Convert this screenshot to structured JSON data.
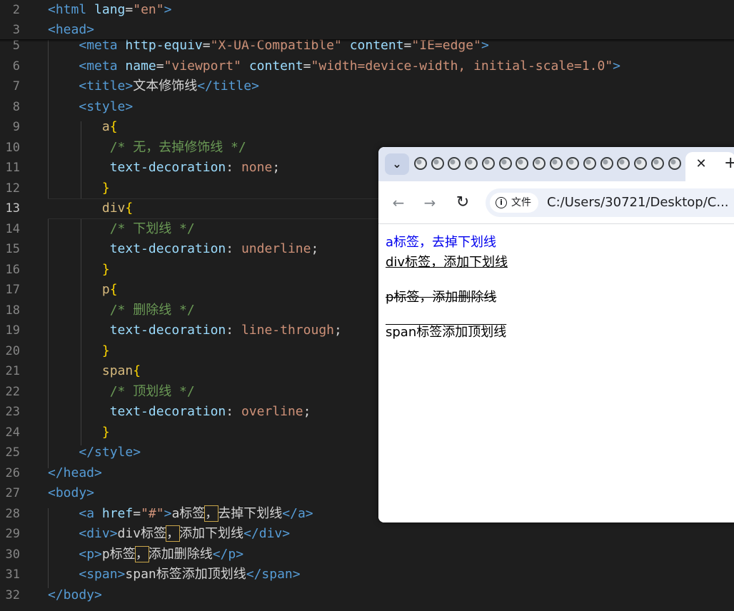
{
  "editor": {
    "lines": [
      {
        "n": "2",
        "tokens": [
          [
            "t-tag",
            "<html "
          ],
          [
            "t-attr",
            "lang"
          ],
          [
            "t-txt",
            "="
          ],
          [
            "t-str",
            "\"en\""
          ],
          [
            "t-tag",
            ">"
          ]
        ]
      },
      {
        "n": "3",
        "tokens": [
          [
            "t-tag",
            "<head>"
          ]
        ]
      },
      {
        "n": "5",
        "tokens": [
          [
            "t-txt",
            "    "
          ],
          [
            "t-tag",
            "<meta "
          ],
          [
            "t-attr",
            "http-equiv"
          ],
          [
            "t-txt",
            "="
          ],
          [
            "t-str",
            "\"X-UA-Compatible\""
          ],
          [
            "t-txt",
            " "
          ],
          [
            "t-attr",
            "content"
          ],
          [
            "t-txt",
            "="
          ],
          [
            "t-str",
            "\"IE=edge\""
          ],
          [
            "t-tag",
            ">"
          ]
        ]
      },
      {
        "n": "6",
        "tokens": [
          [
            "t-txt",
            "    "
          ],
          [
            "t-tag",
            "<meta "
          ],
          [
            "t-attr",
            "name"
          ],
          [
            "t-txt",
            "="
          ],
          [
            "t-str",
            "\"viewport\""
          ],
          [
            "t-txt",
            " "
          ],
          [
            "t-attr",
            "content"
          ],
          [
            "t-txt",
            "="
          ],
          [
            "t-str",
            "\"width=device-width, initial-scale=1.0\""
          ],
          [
            "t-tag",
            ">"
          ]
        ]
      },
      {
        "n": "7",
        "tokens": [
          [
            "t-txt",
            "    "
          ],
          [
            "t-tag",
            "<title>"
          ],
          [
            "t-txt",
            "文本修饰线"
          ],
          [
            "t-tag",
            "</title>"
          ]
        ]
      },
      {
        "n": "8",
        "tokens": [
          [
            "t-txt",
            "    "
          ],
          [
            "t-tag",
            "<style>"
          ]
        ]
      },
      {
        "n": "9",
        "tokens": [
          [
            "t-txt",
            "       "
          ],
          [
            "t-sel",
            "a"
          ],
          [
            "t-brace",
            "{"
          ]
        ]
      },
      {
        "n": "10",
        "tokens": [
          [
            "t-txt",
            "        "
          ],
          [
            "t-cmt",
            "/* 无，去掉修饰线 */"
          ]
        ]
      },
      {
        "n": "11",
        "tokens": [
          [
            "t-txt",
            "        "
          ],
          [
            "t-prop",
            "text-decoration"
          ],
          [
            "t-txt",
            ": "
          ],
          [
            "t-val",
            "none"
          ],
          [
            "t-txt",
            ";"
          ]
        ]
      },
      {
        "n": "12",
        "tokens": [
          [
            "t-txt",
            "       "
          ],
          [
            "t-brace",
            "}"
          ]
        ]
      },
      {
        "n": "13",
        "tokens": [
          [
            "t-txt",
            "       "
          ],
          [
            "t-sel",
            "div"
          ],
          [
            "t-brace",
            "{"
          ]
        ]
      },
      {
        "n": "14",
        "tokens": [
          [
            "t-txt",
            "        "
          ],
          [
            "t-cmt",
            "/* 下划线 */"
          ]
        ]
      },
      {
        "n": "15",
        "tokens": [
          [
            "t-txt",
            "        "
          ],
          [
            "t-prop",
            "text-decoration"
          ],
          [
            "t-txt",
            ": "
          ],
          [
            "t-val",
            "underline"
          ],
          [
            "t-txt",
            ";"
          ]
        ]
      },
      {
        "n": "16",
        "tokens": [
          [
            "t-txt",
            "       "
          ],
          [
            "t-brace",
            "}"
          ]
        ]
      },
      {
        "n": "17",
        "tokens": [
          [
            "t-txt",
            "       "
          ],
          [
            "t-sel",
            "p"
          ],
          [
            "t-brace",
            "{"
          ]
        ]
      },
      {
        "n": "18",
        "tokens": [
          [
            "t-txt",
            "        "
          ],
          [
            "t-cmt",
            "/* 删除线 */"
          ]
        ]
      },
      {
        "n": "19",
        "tokens": [
          [
            "t-txt",
            "        "
          ],
          [
            "t-prop",
            "text-decoration"
          ],
          [
            "t-txt",
            ": "
          ],
          [
            "t-val",
            "line-through"
          ],
          [
            "t-txt",
            ";"
          ]
        ]
      },
      {
        "n": "20",
        "tokens": [
          [
            "t-txt",
            "       "
          ],
          [
            "t-brace",
            "}"
          ]
        ]
      },
      {
        "n": "21",
        "tokens": [
          [
            "t-txt",
            "       "
          ],
          [
            "t-sel",
            "span"
          ],
          [
            "t-brace",
            "{"
          ]
        ]
      },
      {
        "n": "22",
        "tokens": [
          [
            "t-txt",
            "        "
          ],
          [
            "t-cmt",
            "/* 顶划线 */"
          ]
        ]
      },
      {
        "n": "23",
        "tokens": [
          [
            "t-txt",
            "        "
          ],
          [
            "t-prop",
            "text-decoration"
          ],
          [
            "t-txt",
            ": "
          ],
          [
            "t-val",
            "overline"
          ],
          [
            "t-txt",
            ";"
          ]
        ]
      },
      {
        "n": "24",
        "tokens": [
          [
            "t-txt",
            "       "
          ],
          [
            "t-brace",
            "}"
          ]
        ]
      },
      {
        "n": "25",
        "tokens": [
          [
            "t-txt",
            "    "
          ],
          [
            "t-tag",
            "</style>"
          ]
        ]
      },
      {
        "n": "26",
        "tokens": [
          [
            "t-tag",
            "</head>"
          ]
        ]
      },
      {
        "n": "27",
        "tokens": [
          [
            "t-tag",
            "<body>"
          ]
        ]
      },
      {
        "n": "28",
        "tokens": [
          [
            "t-txt",
            "    "
          ],
          [
            "t-tag",
            "<a "
          ],
          [
            "t-attr",
            "href"
          ],
          [
            "t-txt",
            "="
          ],
          [
            "t-str",
            "\"#\""
          ],
          [
            "t-tag",
            ">"
          ],
          [
            "t-txt",
            "a标签"
          ],
          [
            "box",
            "，"
          ],
          [
            "t-txt",
            "去掉下划线"
          ],
          [
            "t-tag",
            "</a>"
          ]
        ]
      },
      {
        "n": "29",
        "tokens": [
          [
            "t-txt",
            "    "
          ],
          [
            "t-tag",
            "<div>"
          ],
          [
            "t-txt",
            "div标签"
          ],
          [
            "box",
            "，"
          ],
          [
            "t-txt",
            "添加下划线"
          ],
          [
            "t-tag",
            "</div>"
          ]
        ]
      },
      {
        "n": "30",
        "tokens": [
          [
            "t-txt",
            "    "
          ],
          [
            "t-tag",
            "<p>"
          ],
          [
            "t-txt",
            "p标签"
          ],
          [
            "box",
            "，"
          ],
          [
            "t-txt",
            "添加删除线"
          ],
          [
            "t-tag",
            "</p>"
          ]
        ]
      },
      {
        "n": "31",
        "tokens": [
          [
            "t-txt",
            "    "
          ],
          [
            "t-tag",
            "<span>"
          ],
          [
            "t-txt",
            "span标签添加顶划线"
          ],
          [
            "t-tag",
            "</span>"
          ]
        ]
      },
      {
        "n": "32",
        "tokens": [
          [
            "t-tag",
            "</body>"
          ]
        ]
      }
    ],
    "current_line": "13"
  },
  "browser": {
    "tab_count_icons": 16,
    "close_glyph": "✕",
    "new_tab_glyph": "+",
    "tab_menu_glyph": "⌄",
    "back_glyph": "←",
    "forward_glyph": "→",
    "reload_glyph": "↻",
    "info_glyph": "i",
    "site_chip_label": "文件",
    "url": "C:/Users/30721/Desktop/C...",
    "content": {
      "a_text": "a标签，去掉下划线",
      "div_text": "div标签，添加下划线",
      "p_text": "p标签，添加删除线",
      "span_text": "span标签添加顶划线"
    }
  },
  "colors": {
    "editor_bg": "#1e1e1e",
    "tag": "#569cd6",
    "attr": "#9cdcfe",
    "string": "#ce9178",
    "comment": "#6a9955",
    "brace": "#ffd700",
    "selector": "#d7ba7d",
    "link": "#0000ee"
  }
}
